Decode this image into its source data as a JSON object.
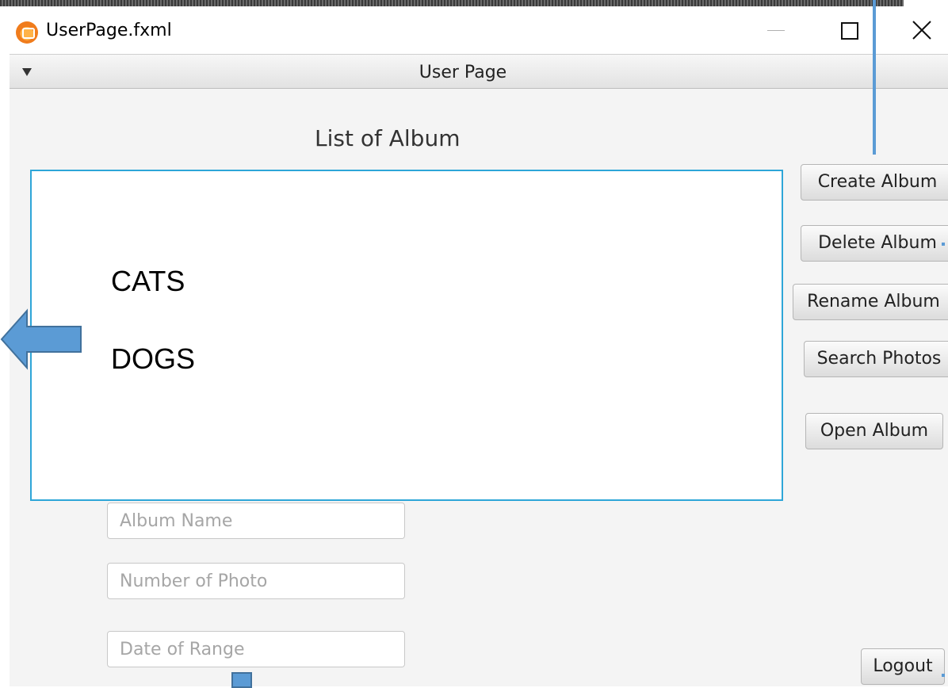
{
  "window": {
    "title": "UserPage.fxml"
  },
  "pane": {
    "title": "User Page"
  },
  "list": {
    "heading": "List of Album",
    "items": [
      "CATS",
      "DOGS"
    ]
  },
  "fields": {
    "album_name": "Album Name",
    "number_of_photo": "Number of Photo",
    "date_of_range": "Date of Range"
  },
  "buttons": {
    "create": "Create Album",
    "delete": "Delete Album",
    "rename": "Rename Album",
    "search": "Search Photos",
    "open": "Open Album",
    "logout": "Logout"
  },
  "colors": {
    "accent": "#2ea6d8",
    "annotation": "#5b9bd5"
  },
  "icons": {
    "app": "app-logo-icon",
    "minimize": "minimize-icon",
    "maximize": "maximize-icon",
    "close": "close-icon",
    "collapse": "triangle-down-icon",
    "annotation_arrow": "left-arrow-icon"
  }
}
